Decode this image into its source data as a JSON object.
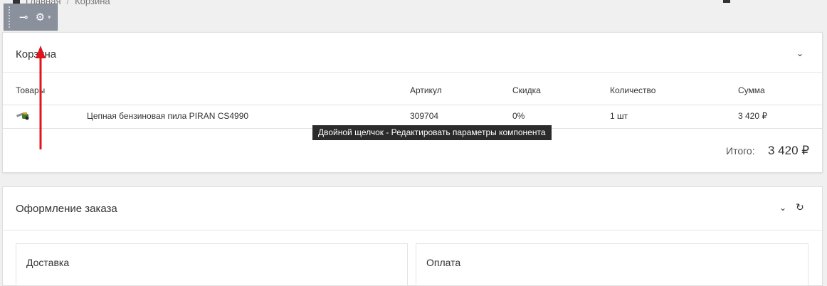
{
  "breadcrumb": {
    "home": "Главная",
    "separator": "/",
    "current": "Корзина"
  },
  "toolbar": {
    "pin_icon": "⊸",
    "gear_icon": "⚙",
    "caret": "▾"
  },
  "cart": {
    "title": "Корзина",
    "collapse_icon": "⌄",
    "columns": {
      "product": "Товары",
      "article": "Артикул",
      "discount": "Скидка",
      "quantity": "Количество",
      "sum": "Сумма"
    },
    "items": [
      {
        "name": "Цепная бензиновая пила PIRAN CS4990",
        "article": "309704",
        "discount": "0%",
        "quantity": "1 шт",
        "sum": "3 420 ₽"
      }
    ],
    "total_label": "Итого:",
    "total_value": "3 420 ₽"
  },
  "tooltip": "Двойной щелчок - Редактировать параметры компонента",
  "order": {
    "title": "Оформление заказа",
    "collapse_icon": "⌄",
    "refresh_icon": "↻",
    "delivery_title": "Доставка",
    "payment_title": "Оплата"
  },
  "colors": {
    "toolbar_bg": "#8a919c",
    "arrow": "#e0141b",
    "tooltip_bg": "#2b2b2b"
  }
}
